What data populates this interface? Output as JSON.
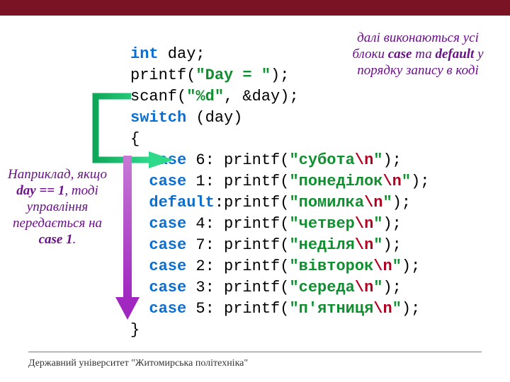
{
  "code": {
    "l1_int": "int",
    "l1_rest": " day;",
    "l2_a": "printf(",
    "l2_str": "\"Day = \"",
    "l2_b": ");",
    "l3_a": "scanf(",
    "l3_str": "\"%d\"",
    "l3_b": ", &day);",
    "l4_sw": "switch",
    "l4_b": " (day)",
    "l5": "{",
    "l6_case": "  case",
    "l6_a": " 6: printf(",
    "l6_str": "\"субота",
    "l6_esc": "\\n",
    "l6_q": "\"",
    "l6_b": ");",
    "l7_a": " 1: printf(",
    "l7_str": "\"понеділок",
    "l8_def": "  default",
    "l8_a": ":printf(",
    "l8_str": "\"помилка",
    "l9_a": " 4: printf(",
    "l9_str": "\"четвер",
    "l10_a": " 7: printf(",
    "l10_str": "\"неділя",
    "l11_a": " 2: printf(",
    "l11_str": "\"вівторок",
    "l12_a": " 3: printf(",
    "l12_str": "\"середа",
    "l13_a": " 5: printf(",
    "l13_str": "\"п'ятниця",
    "l14": "}"
  },
  "notes": {
    "right_pre": "далі виконаються усі блоки ",
    "right_case": "case",
    "right_mid": " та ",
    "right_def": "default",
    "right_post": " у порядку запису в коді",
    "left_pre": "Наприклад, якщо ",
    "left_day": "day == 1",
    "left_mid": ", тоді управління передається на ",
    "left_case1": "case 1",
    "left_dot": "."
  },
  "footer": "Державний університет \"Житомирська політехніка\""
}
